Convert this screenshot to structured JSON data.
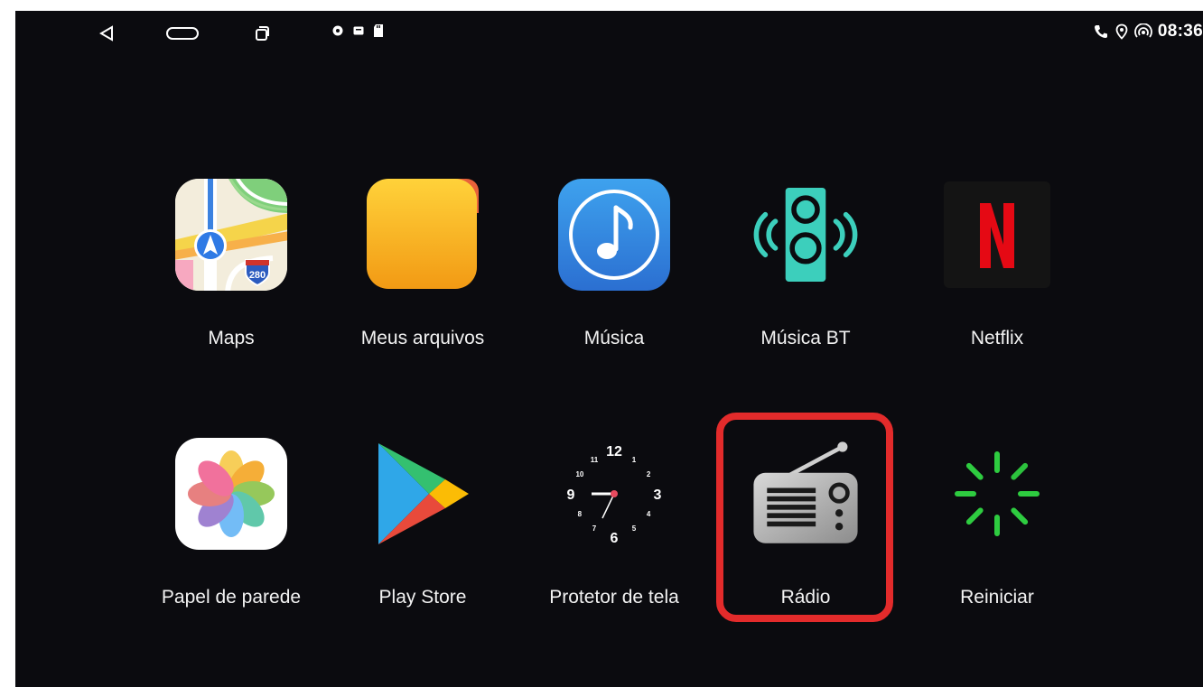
{
  "statusbar": {
    "time": "08:36",
    "nav": [
      "back",
      "home",
      "recent-apps"
    ],
    "notification_icons": [
      "location-dot-icon",
      "square-icon",
      "sd-card-icon"
    ],
    "status_icons": [
      "phone-icon",
      "location-pin-icon",
      "hotspot-icon"
    ]
  },
  "apps": [
    {
      "label": "Maps",
      "icon": "maps-icon"
    },
    {
      "label": "Meus arquivos",
      "icon": "folder-icon"
    },
    {
      "label": "Música",
      "icon": "music-note-icon"
    },
    {
      "label": "Música BT",
      "icon": "bluetooth-speaker-icon"
    },
    {
      "label": "Netflix",
      "icon": "netflix-icon"
    },
    {
      "label": "Papel de parede",
      "icon": "photos-flower-icon"
    },
    {
      "label": "Play Store",
      "icon": "play-store-icon"
    },
    {
      "label": "Protetor de tela",
      "icon": "clock-icon"
    },
    {
      "label": "Rádio",
      "icon": "radio-icon",
      "highlighted": true
    },
    {
      "label": "Reiniciar",
      "icon": "restart-spinner-icon"
    }
  ],
  "clock_face": {
    "numbers": [
      "12",
      "1",
      "2",
      "3",
      "4",
      "5",
      "6",
      "7",
      "8",
      "9",
      "10",
      "11"
    ]
  },
  "netflix_letter": "N",
  "maps_shield": "280",
  "colors": {
    "background": "#0b0b0f",
    "highlight": "#e32b2b",
    "restart_green": "#2ecc40"
  }
}
